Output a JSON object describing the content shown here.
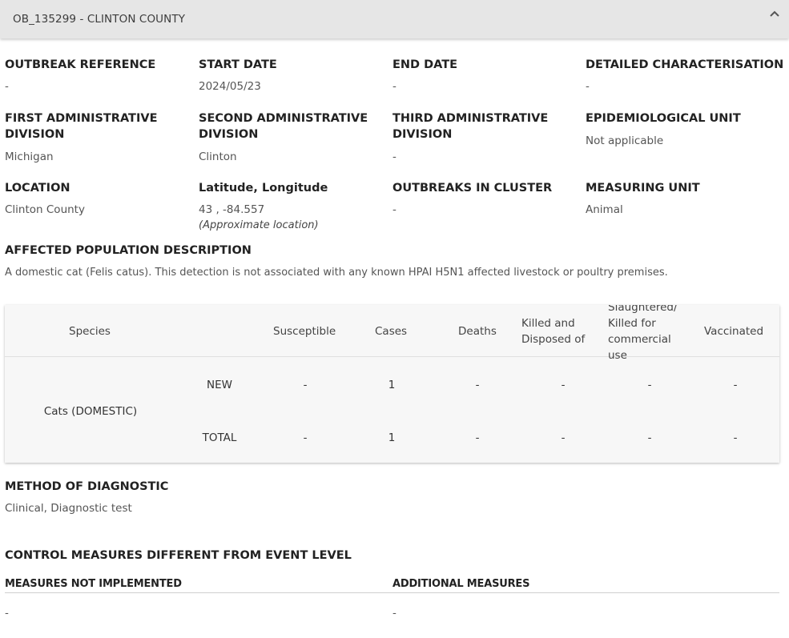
{
  "header": {
    "title": "OB_135299 - CLINTON COUNTY"
  },
  "fields": {
    "outbreak_reference": {
      "label": "OUTBREAK REFERENCE",
      "value": "-"
    },
    "start_date": {
      "label": "START DATE",
      "value": "2024/05/23"
    },
    "end_date": {
      "label": "END DATE",
      "value": "-"
    },
    "detailed_characterisation": {
      "label": "DETAILED CHARACTERISATION",
      "value": "-"
    },
    "first_admin": {
      "label_1": "FIRST ADMINISTRATIVE",
      "label_2": "DIVISION",
      "value": "Michigan"
    },
    "second_admin": {
      "label_1": "SECOND ADMINISTRATIVE",
      "label_2": "DIVISION",
      "value": "Clinton"
    },
    "third_admin": {
      "label_1": "THIRD ADMINISTRATIVE",
      "label_2": "DIVISION",
      "value": "-"
    },
    "epi_unit": {
      "label": "EPIDEMIOLOGICAL UNIT",
      "value": "Not applicable"
    },
    "location": {
      "label": "LOCATION",
      "value": "Clinton County"
    },
    "lat_long": {
      "label": "Latitude, Longitude",
      "value": "43 , -84.557",
      "note": "(Approximate location)"
    },
    "outbreaks_in_cluster": {
      "label": "OUTBREAKS IN CLUSTER",
      "value": "-"
    },
    "measuring_unit": {
      "label": "MEASURING UNIT",
      "value": "Animal"
    }
  },
  "affected_population": {
    "label": "AFFECTED POPULATION DESCRIPTION",
    "text": "A domestic cat (Felis catus). This detection is not associated with any known HPAI H5N1 affected livestock or poultry premises."
  },
  "species_table": {
    "headers": {
      "species": "Species",
      "susceptible": "Susceptible",
      "cases": "Cases",
      "deaths": "Deaths",
      "killed_1": "Killed and",
      "killed_2": "Disposed of",
      "slaughtered_1": "Slaughtered/",
      "slaughtered_2": "Killed for",
      "slaughtered_3": "commercial",
      "slaughtered_4": "use",
      "vaccinated": "Vaccinated"
    },
    "species_name": "Cats (DOMESTIC)",
    "rows": [
      {
        "kind": "NEW",
        "susceptible": "-",
        "cases": "1",
        "deaths": "-",
        "killed": "-",
        "slaughtered": "-",
        "vaccinated": "-"
      },
      {
        "kind": "TOTAL",
        "susceptible": "-",
        "cases": "1",
        "deaths": "-",
        "killed": "-",
        "slaughtered": "-",
        "vaccinated": "-"
      }
    ]
  },
  "diagnostic": {
    "label": "METHOD OF DIAGNOSTIC",
    "value": "Clinical, Diagnostic test"
  },
  "control_measures": {
    "label": "CONTROL MEASURES DIFFERENT FROM EVENT LEVEL",
    "not_implemented_label": "MEASURES NOT IMPLEMENTED",
    "not_implemented_value": "-",
    "additional_label": "ADDITIONAL MEASURES",
    "additional_value": "-"
  }
}
